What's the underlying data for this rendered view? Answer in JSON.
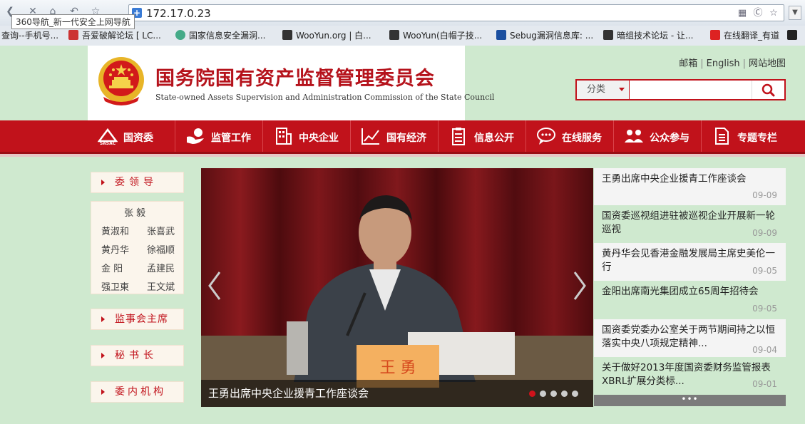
{
  "browser": {
    "url": "172.17.0.23",
    "tooltip": "360导航_新一代安全上网导航",
    "bookmarks": [
      {
        "label": "查询--手机号...",
        "color": "#9ab"
      },
      {
        "label": "吾爱破解论坛 [ LC...",
        "color": "#c33"
      },
      {
        "label": "国家信息安全漏洞...",
        "color": "#4a8"
      },
      {
        "label": "WooYun.org | 白...",
        "color": "#333"
      },
      {
        "label": "WooYun(白帽子技...",
        "color": "#333"
      },
      {
        "label": "Sebug漏洞信息库: ...",
        "color": "#1a4fa0"
      },
      {
        "label": "暗组技术论坛 - 让...",
        "color": "#333"
      },
      {
        "label": "在线翻译_有道",
        "color": "#d22"
      },
      {
        "label": "",
        "color": "#222"
      }
    ]
  },
  "header": {
    "title_cn": "国务院国有资产监督管理委员会",
    "title_en": "State-owned Assets Supervision and Administration Commission of the State Council",
    "links": [
      "邮箱",
      "English",
      "网站地图"
    ],
    "search": {
      "category": "分类",
      "placeholder": ""
    }
  },
  "nav": [
    {
      "label": "国资委",
      "icon": "sasac-logo-icon"
    },
    {
      "label": "监管工作",
      "icon": "hand-icon"
    },
    {
      "label": "中央企业",
      "icon": "building-icon"
    },
    {
      "label": "国有经济",
      "icon": "chart-icon"
    },
    {
      "label": "信息公开",
      "icon": "clipboard-icon"
    },
    {
      "label": "在线服务",
      "icon": "chat-icon"
    },
    {
      "label": "公众参与",
      "icon": "people-icon"
    },
    {
      "label": "专题专栏",
      "icon": "document-icon"
    }
  ],
  "sidebar": {
    "leaders_heading": "委领导",
    "leaders": [
      "张 毅",
      "黄淑和",
      "张喜武",
      "黄丹华",
      "徐福顺",
      "金 阳",
      "孟建民",
      "强卫東",
      "王文斌"
    ],
    "headings": [
      "监事会主席",
      "秘书长",
      "委内机构"
    ]
  },
  "carousel": {
    "caption": "王勇出席中央企业援青工作座谈会",
    "nameplate": "王 勇",
    "active_slide": 0,
    "slide_count": 5
  },
  "news": [
    {
      "title": "王勇出席中央企业援青工作座谈会",
      "date": "09-09"
    },
    {
      "title": "国资委巡视组进驻被巡视企业开展新一轮巡视",
      "date": "09-09"
    },
    {
      "title": "黄丹华会见香港金融发展局主席史美伦一行",
      "date": "09-05"
    },
    {
      "title": "金阳出席南光集团成立65周年招待会",
      "date": "09-05"
    },
    {
      "title": "国资委党委办公室关于两节期间持之以恒落实中央八项规定精神...",
      "date": "09-04"
    },
    {
      "title": "关于做好2013年度国资委财务监管报表XBRL扩展分类标...",
      "date": "09-01"
    }
  ],
  "news_more": "•••",
  "colors": {
    "brand_red": "#c1121b",
    "page_bg": "#cfe9cf"
  }
}
